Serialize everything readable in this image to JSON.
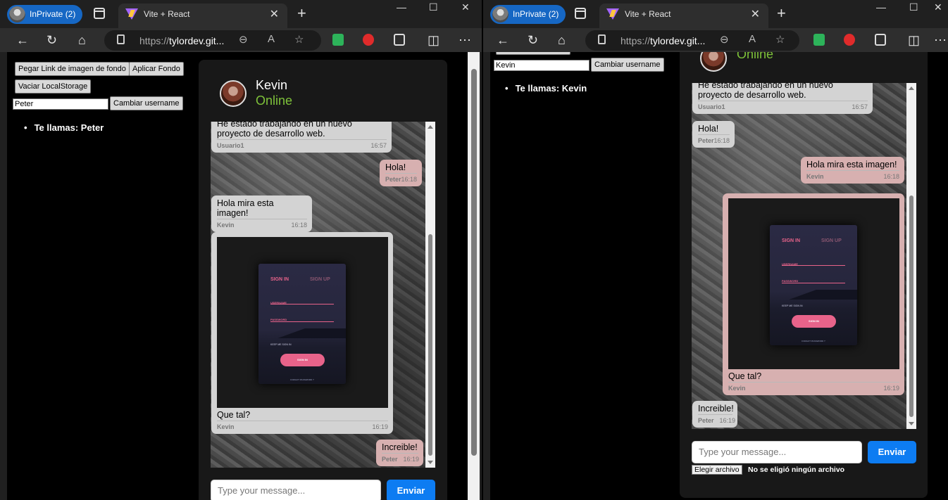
{
  "browser": {
    "inprivate_label": "InPrivate (2)",
    "tab_title": "Vite + React",
    "url_prefix": "https://",
    "url_host": "tylordev.git...",
    "close_tab": "✕",
    "new_tab": "+",
    "min": "—",
    "max": "☐",
    "close": "✕",
    "back": "←",
    "reload": "↻",
    "home": "⌂",
    "zoom": "⊖",
    "read_aloud": "A",
    "favorite": "☆",
    "split": "◫",
    "more": "⋯"
  },
  "controls": {
    "paste_bg_label": "Pegar Link de imagen de fondo",
    "apply_bg_label": "Aplicar Fondo",
    "clear_storage_label": "Vaciar LocalStorage",
    "change_username_label": "Cambiar username"
  },
  "left": {
    "username_value": "Peter",
    "you_are": "Te llamas: Peter",
    "contact_name": "Kevin",
    "contact_status": "Online",
    "messages": [
      {
        "text": "He estado trabajando en un nuevo proyecto de desarrollo web.",
        "sender": "Usuario1",
        "time": "16:57"
      },
      {
        "text": "Hola!",
        "sender": "Peter",
        "time": "16:18"
      },
      {
        "text": "Hola mira esta imagen!",
        "sender": "Kevin",
        "time": "16:18"
      },
      {
        "text": "Que tal?",
        "sender": "Kevin",
        "time": "16:19"
      },
      {
        "text": "Increible!",
        "sender": "Peter",
        "time": "16:19"
      }
    ],
    "input_placeholder": "Type your message...",
    "send_label": "Enviar"
  },
  "right": {
    "username_value": "Kevin",
    "you_are": "Te llamas: Kevin",
    "contact_status": "Online",
    "messages": [
      {
        "text": "He estado trabajando en un nuevo proyecto de desarrollo web.",
        "sender": "Usuario1",
        "time": "16:57"
      },
      {
        "text": "Hola!",
        "sender": "Peter",
        "time": "16:18"
      },
      {
        "text": "Hola mira esta imagen!",
        "sender": "Kevin",
        "time": "16:18"
      },
      {
        "text": "Que tal?",
        "sender": "Kevin",
        "time": "16:19"
      },
      {
        "text": "Increible!",
        "sender": "Peter",
        "time": "16:19"
      }
    ],
    "input_placeholder": "Type your message...",
    "send_label": "Enviar",
    "file_button": "Elegir archivo",
    "file_status": "No se eligió ningún archivo"
  },
  "shared_image": {
    "sign_in": "SIGN IN",
    "sign_up": "SIGN UP",
    "username": "USERNAME",
    "password": "PASSWORD",
    "keep": "KEEP ME SIGN IN",
    "button": "SIGN IN",
    "forgot": "FORGOT PASSWORD ?"
  },
  "colors": {
    "accent_send": "#0d7cf2",
    "online": "#7ec23a",
    "inprivate": "#1667c4",
    "bubble_other": "#d3d3d3",
    "bubble_me": "#d7b0b0"
  }
}
